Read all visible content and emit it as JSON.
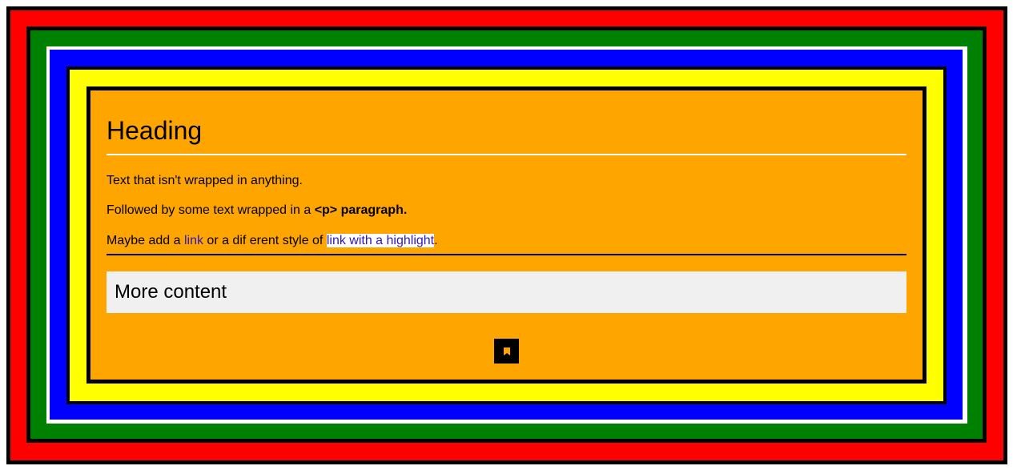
{
  "colors": {
    "outer_frame": "#ff0000",
    "second_frame": "#008000",
    "third_frame": "#0000ff",
    "fourth_frame": "#ffff00",
    "content_frame": "#ffa500",
    "border": "#000000",
    "link": "#2b18c8",
    "panel": "#f0f0f0"
  },
  "content": {
    "heading": "Heading",
    "text_plain": "Text that isn't wrapped in anything.",
    "text_paragraph_prefix": "Followed by some text wrapped in a ",
    "text_paragraph_bold": "<p> paragraph.",
    "links_line": {
      "prefix": "Maybe add a ",
      "link": "link",
      "middle": " or a dif erent style of ",
      "highlight_link": "link with a highlight",
      "suffix": "."
    },
    "more_content": "More content"
  },
  "icons": {
    "bottom_icon": "bookmark-icon"
  }
}
